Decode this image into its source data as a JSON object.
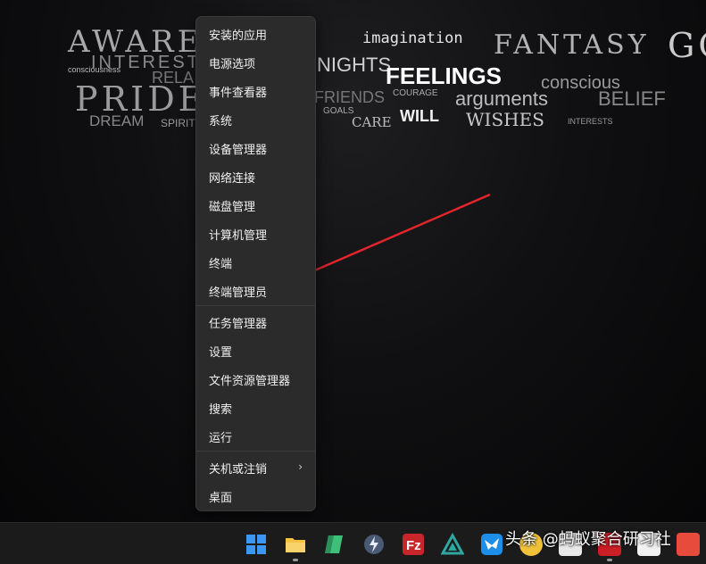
{
  "wallpaper_words": [
    "AWARENE",
    "INTERESTS",
    "PRIDE",
    "RELA",
    "DREAM",
    "SPIRIT",
    "consciousness",
    "imagination",
    "FEELINGS",
    "CARE",
    "WILL",
    "WISHES",
    "FANTASY",
    "FRIENDS",
    "GOALS",
    "arguments",
    "conscious",
    "BELIEF",
    "COURAGE",
    "NIGHTS",
    "GO",
    "INTERESTS"
  ],
  "context_menu": {
    "items": [
      {
        "label": "安装的应用"
      },
      {
        "label": "电源选项"
      },
      {
        "label": "事件查看器"
      },
      {
        "label": "系统"
      },
      {
        "label": "设备管理器"
      },
      {
        "label": "网络连接"
      },
      {
        "label": "磁盘管理"
      },
      {
        "label": "计算机管理"
      },
      {
        "label": "终端"
      },
      {
        "label": "终端管理员"
      },
      {
        "label": "任务管理器"
      },
      {
        "label": "设置"
      },
      {
        "label": "文件资源管理器"
      },
      {
        "label": "搜索"
      },
      {
        "label": "运行"
      },
      {
        "label": "关机或注销"
      },
      {
        "label": "桌面"
      }
    ],
    "submenu_chevron": "›"
  },
  "annotation": {
    "color": "#e0252b",
    "points_to": "终端管理员"
  },
  "taskbar": {
    "icons": [
      {
        "name": "start-icon",
        "color": "#2b8cf0"
      },
      {
        "name": "file-explorer-icon",
        "color": "#f5c242"
      },
      {
        "name": "notes-app-icon",
        "color": "#3fc07a"
      },
      {
        "name": "bolt-app-icon",
        "color": "#5a6d8c"
      },
      {
        "name": "filezilla-icon",
        "color": "#c8262b"
      },
      {
        "name": "triangle-app-icon",
        "color": "#2fa6a0"
      },
      {
        "name": "bird-app-icon",
        "color": "#1e8fe8"
      }
    ]
  },
  "watermark": "头条 @蚂蚁聚合研习社"
}
